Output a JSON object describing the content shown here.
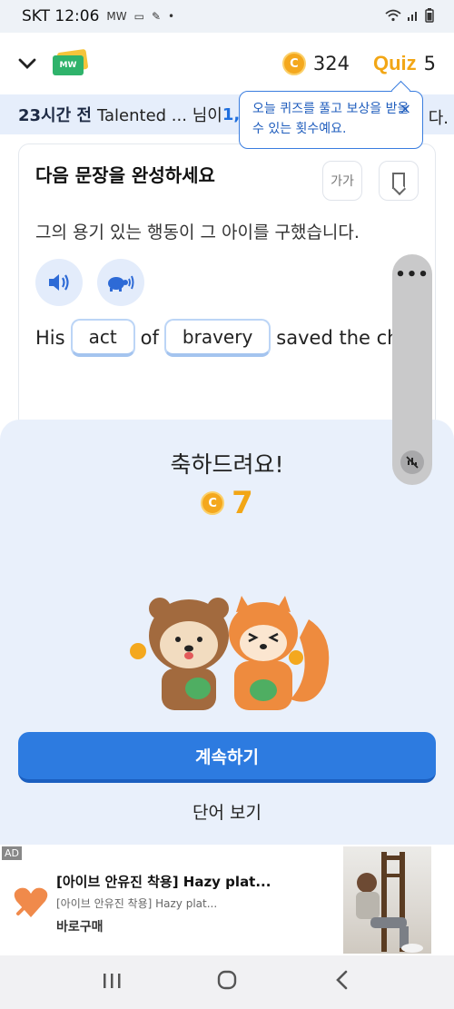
{
  "status_bar": {
    "carrier_time": "SKT 12:06",
    "extra_icons": "MW"
  },
  "header": {
    "logo_text": "MW",
    "coin_count": "324",
    "quiz_logo": "Quiz",
    "quiz_count": "5"
  },
  "ticker": {
    "time": "23시간 전",
    "text": "Talented ... 님이",
    "highlight": "1,",
    "tail": "다."
  },
  "tooltip": {
    "text": "오늘 퀴즈를 풀고 보상을 받을 수 있는 횟수예요.",
    "close": "×"
  },
  "question": {
    "title": "다음 문장을 완성하세요",
    "font_button": "가가",
    "korean_sentence": "그의 용기 있는 행동이 그 아이를 구했습니다.",
    "english": {
      "w1": "His",
      "blank1": "act",
      "w2": "of",
      "blank2": "bravery",
      "w3": "saved the chi"
    }
  },
  "result": {
    "congrats": "축하드려요!",
    "reward": "7",
    "continue_label": "계속하기",
    "view_words_label": "단어 보기"
  },
  "ad": {
    "tag": "AD",
    "title": "[아이브 안유진 착용] Hazy plat...",
    "subtitle": "[아이브 안유진 착용] Hazy plat...",
    "cta": "바로구매"
  },
  "colors": {
    "primary": "#2d7be0",
    "coin": "#f4a81e",
    "quiz": "#f2a615",
    "sheet": "#e9f0fb"
  }
}
